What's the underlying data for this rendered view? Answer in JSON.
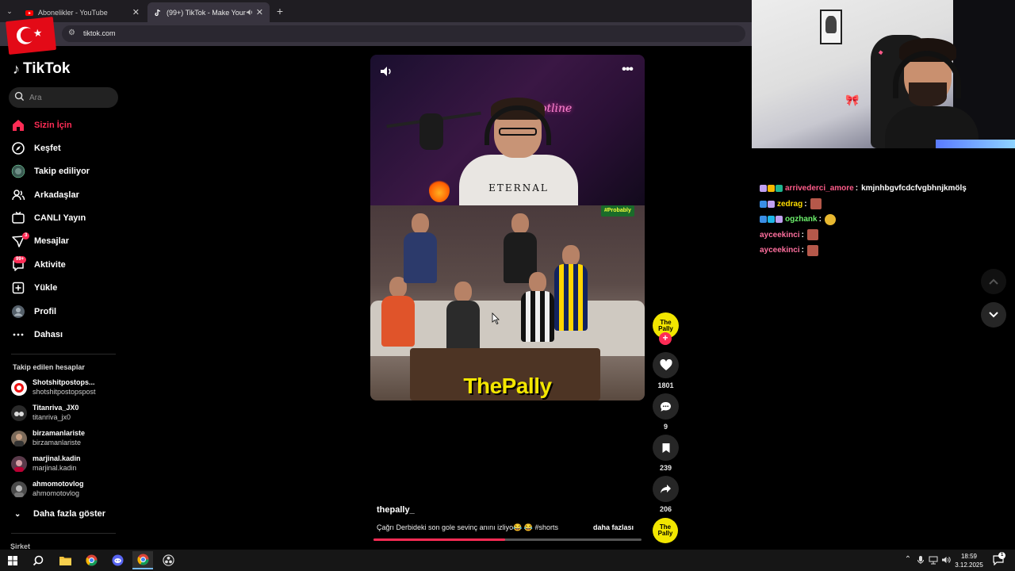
{
  "browser": {
    "tabs": [
      {
        "label": "Abonelikler - YouTube",
        "active": false
      },
      {
        "label": "(99+) TikTok - Make Your Day",
        "active": true
      }
    ],
    "url": "tiktok.com"
  },
  "sidebar": {
    "logo": "TikTok",
    "search_placeholder": "Ara",
    "nav": [
      {
        "label": "Sizin İçin",
        "icon": "home-icon",
        "active": true
      },
      {
        "label": "Keşfet",
        "icon": "compass-icon"
      },
      {
        "label": "Takip ediliyor",
        "icon": "following-avatar-icon"
      },
      {
        "label": "Arkadaşlar",
        "icon": "friends-icon"
      },
      {
        "label": "CANLI Yayın",
        "icon": "live-icon"
      },
      {
        "label": "Mesajlar",
        "icon": "messages-icon",
        "badge": "3"
      },
      {
        "label": "Aktivite",
        "icon": "activity-icon",
        "badge": "99+"
      },
      {
        "label": "Yükle",
        "icon": "upload-icon"
      },
      {
        "label": "Profil",
        "icon": "profile-avatar-icon"
      },
      {
        "label": "Dahası",
        "icon": "more-dots-icon"
      }
    ],
    "following_title": "Takip edilen hesaplar",
    "following": [
      {
        "name": "Shotshitpostops...",
        "username": "shotshitpostopspost"
      },
      {
        "name": "Titanriva_JX0",
        "username": "titanriva_jx0"
      },
      {
        "name": "birzamanlariste",
        "username": "birzamanlariste"
      },
      {
        "name": "marjinal.kadin",
        "username": "marjinal.kadin"
      },
      {
        "name": "ahmomotovlog",
        "username": "ahmomotovlog"
      }
    ],
    "show_more": "Daha fazla göster",
    "company": "Şirket"
  },
  "video": {
    "shirt_text": "ETERNAL",
    "neon_text": "hotline",
    "sticker": "#Probably",
    "brand_text": "ThePally",
    "creator_avatar_text": "The Pally",
    "username": "thepally_",
    "description": "Çağrı Derbideki son gole sevinç anını izliyo😂 😂 #shorts",
    "more_label": "daha fazlası",
    "progress": 0.49,
    "actions": {
      "likes": "1801",
      "comments": "9",
      "saves": "239",
      "shares": "206"
    }
  },
  "chat": [
    {
      "user": "arrivederci_amore",
      "color": "#ff5c8a",
      "message": "kmjnhbgvfcdcfvgbhnjkmölş",
      "emote": false
    },
    {
      "user": "zedrag",
      "color": "#ffdd00",
      "message": "",
      "emote": true
    },
    {
      "user": "ogzhank",
      "color": "#6cf06c",
      "message": "",
      "emote": true
    },
    {
      "user": "ayceekinci",
      "color": "#ff6f9e",
      "message": "",
      "emote": true
    },
    {
      "user": "ayceekinci",
      "color": "#ff6f9e",
      "message": "",
      "emote": true
    }
  ],
  "taskbar": {
    "time": "18:59",
    "date": "3.12.2025",
    "notification_count": "1"
  },
  "colors": {
    "tiktok_red": "#fe2c55",
    "background": "#000000"
  }
}
